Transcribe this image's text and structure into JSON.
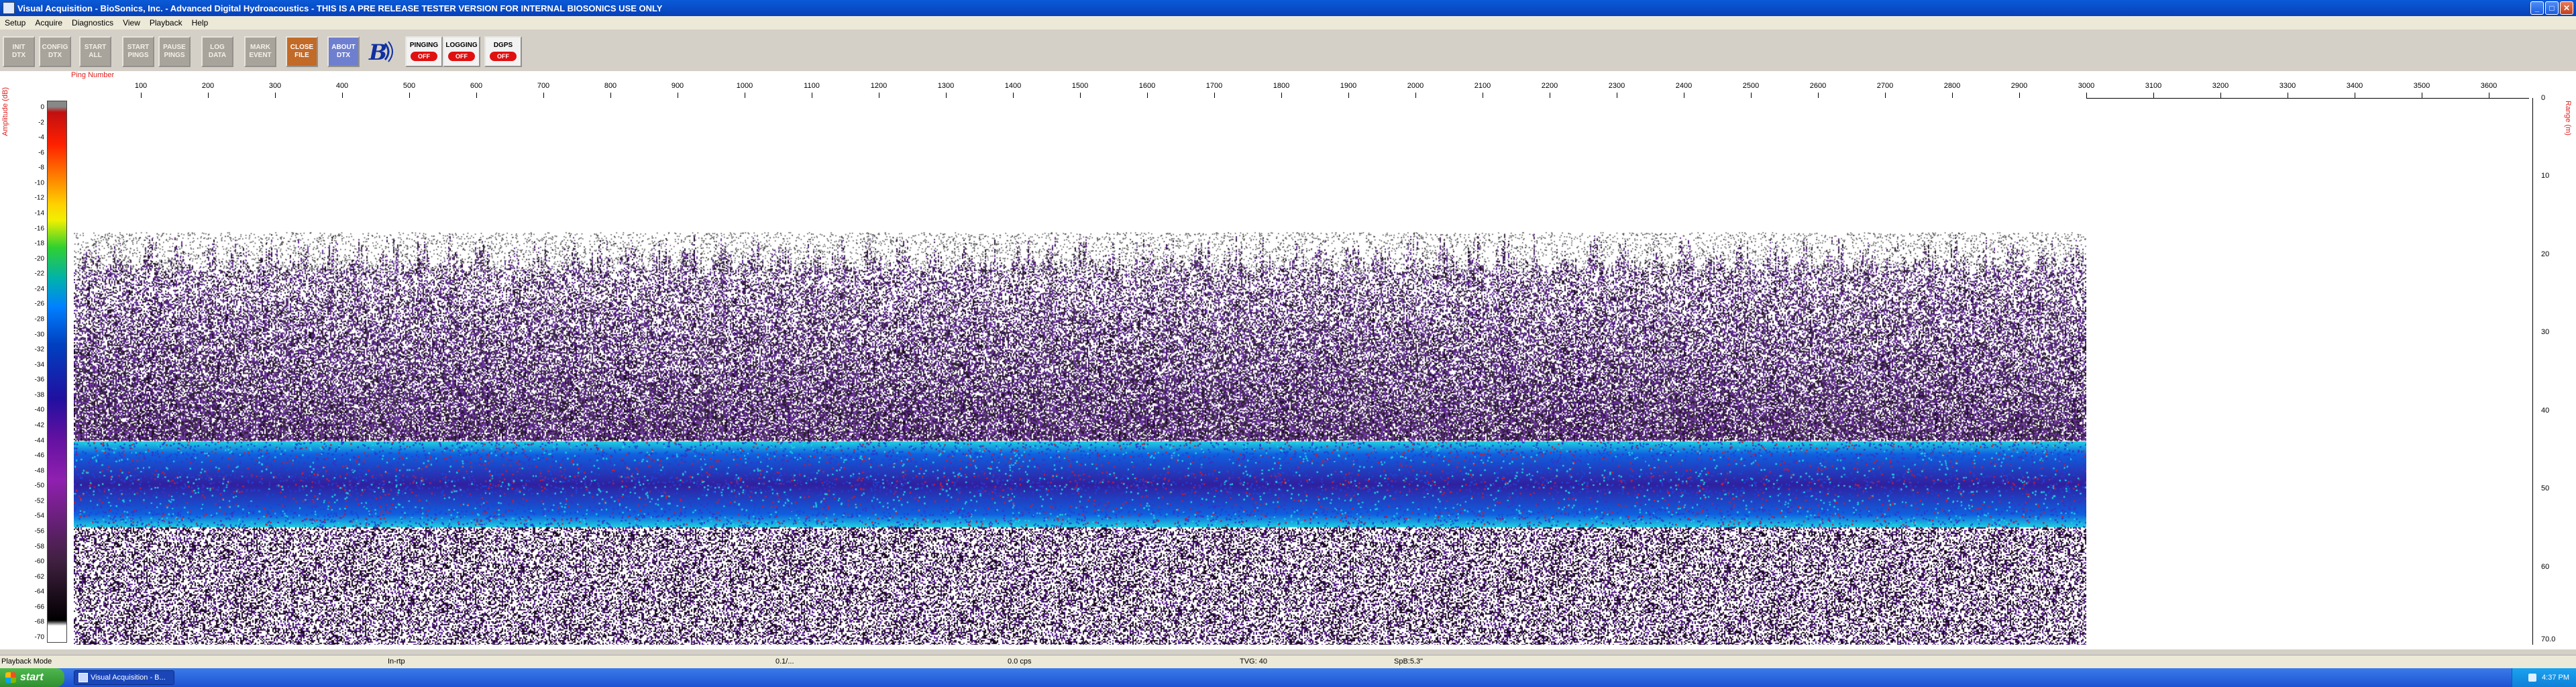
{
  "window": {
    "title": "Visual Acquisition  -  BioSonics, Inc.  -  Advanced Digital Hydroacoustics  -  THIS IS A PRE RELEASE TESTER VERSION FOR INTERNAL BIOSONICS USE ONLY"
  },
  "menu": [
    "Setup",
    "Acquire",
    "Diagnostics",
    "View",
    "Playback",
    "Help"
  ],
  "toolbar": {
    "buttons": [
      {
        "label": "INIT\nDTX",
        "style": "gray"
      },
      {
        "label": "CONFIG\nDTX",
        "style": "gray"
      },
      {
        "label": "START\nALL",
        "style": "gray"
      },
      {
        "label": "START\nPINGS",
        "style": "gray"
      },
      {
        "label": "PAUSE\nPINGS",
        "style": "gray"
      },
      {
        "label": "LOG\nDATA",
        "style": "gray"
      },
      {
        "label": "MARK\nEVENT",
        "style": "gray"
      },
      {
        "label": "CLOSE\nFILE",
        "style": "orange"
      },
      {
        "label": "ABOUT\nDTX",
        "style": "blue"
      }
    ],
    "status": [
      {
        "label": "PINGING",
        "state": "OFF"
      },
      {
        "label": "LOGGING",
        "state": "OFF"
      },
      {
        "label": "DGPS",
        "state": "OFF"
      }
    ]
  },
  "echogram": {
    "scale_label": "Amplitude (dB)",
    "ping_label": "Ping Number",
    "range_label": "Range (m)",
    "db_ticks": [
      "0",
      "-2",
      "-4",
      "-6",
      "-8",
      "-10",
      "-12",
      "-14",
      "-16",
      "-18",
      "-20",
      "-22",
      "-24",
      "-26",
      "-28",
      "-30",
      "-32",
      "-34",
      "-36",
      "-38",
      "-40",
      "-42",
      "-44",
      "-46",
      "-48",
      "-50",
      "-52",
      "-54",
      "-56",
      "-58",
      "-60",
      "-62",
      "-64",
      "-66",
      "-68",
      "-70"
    ],
    "x_ticks": [
      "100",
      "200",
      "300",
      "400",
      "500",
      "600",
      "700",
      "800",
      "900",
      "1000",
      "1100",
      "1200",
      "1300",
      "1400",
      "1500",
      "1600",
      "1700",
      "1800",
      "1900",
      "2000",
      "2100",
      "2200",
      "2300",
      "2400",
      "2500",
      "2600",
      "2700",
      "2800",
      "2900",
      "3000",
      "3100",
      "3200",
      "3300",
      "3400",
      "3500",
      "3600"
    ],
    "range_ticks": [
      "0",
      "10",
      "20",
      "30",
      "40",
      "50",
      "60",
      "70.0"
    ],
    "colors": {
      "band_main": "#1060e0",
      "band_light": "#20d0e0",
      "noise": "#5a2090",
      "dark": "#1a0a20",
      "red": "#c02040"
    }
  },
  "statusbar": [
    "Playback Mode",
    "In-rtp",
    "0.1/...",
    "0.0 cps",
    "TVG: 40",
    "SpB:5.3\""
  ],
  "taskbar": {
    "start": "start",
    "task": "Visual Acquisition - B...",
    "clock": "4:37 PM"
  }
}
